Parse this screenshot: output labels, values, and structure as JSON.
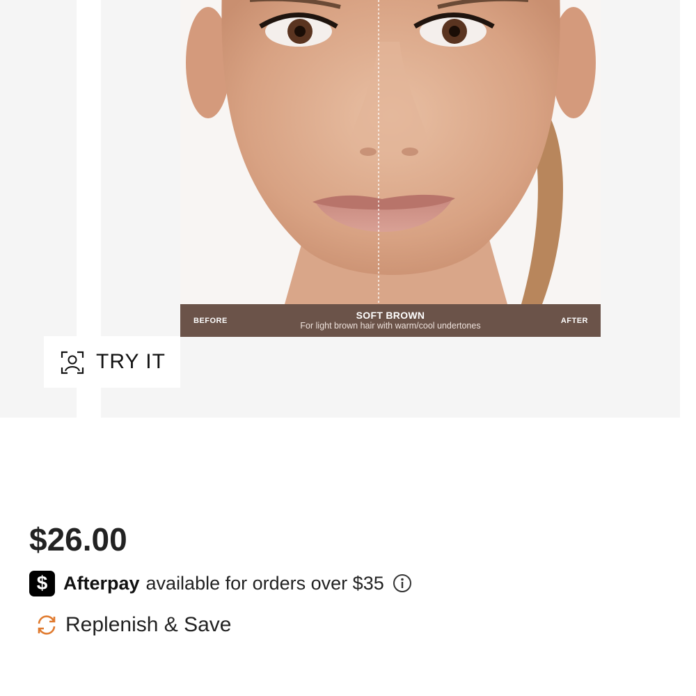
{
  "gallery": {
    "caption": {
      "before": "BEFORE",
      "after": "AFTER",
      "shade_name": "SOFT BROWN",
      "shade_description": "For light brown hair with warm/cool undertones"
    },
    "try_it_label": "TRY IT"
  },
  "pricing": {
    "price": "$26.00",
    "afterpay": {
      "brand": "Afterpay",
      "text": "available for orders over $35",
      "badge_symbol": "$"
    },
    "replenish_label": "Replenish & Save"
  },
  "icons": {
    "try_it": "face-scan-icon",
    "afterpay": "afterpay-logo-icon",
    "info": "info-icon",
    "replenish": "replenish-icon"
  },
  "colors": {
    "caption_bar": "#6b5349",
    "panel_bg": "#f5f5f5",
    "replenish_accent": "#e07a2e"
  }
}
